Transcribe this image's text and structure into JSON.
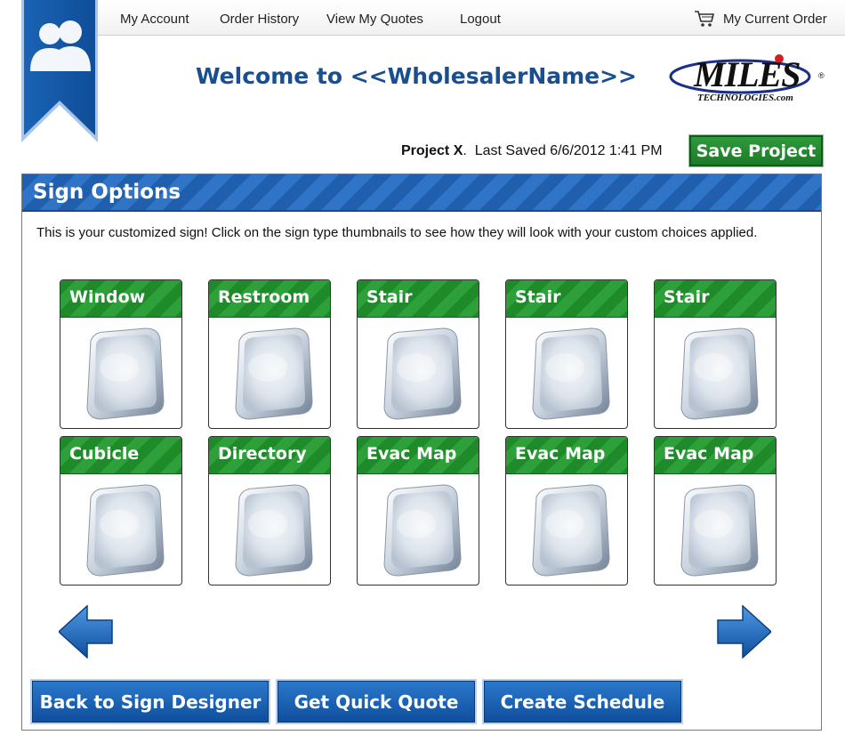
{
  "nav": {
    "my_account": "My Account",
    "order_history": "Order History",
    "view_quotes": "View My Quotes",
    "logout": "Logout",
    "current_order": "My Current Order"
  },
  "header": {
    "welcome": "Welcome to <<WholesalerName>>",
    "logo_main": "MILES",
    "logo_sub": "TECHNOLOGIES.com",
    "logo_reg": "®"
  },
  "project": {
    "name": "Project X",
    "separator": ".",
    "saved_text": "Last Saved 6/6/2012  1:41 PM",
    "save_button": "Save Project"
  },
  "panel": {
    "title": "Sign Options",
    "intro": "This is your customized sign!  Click on the sign type thumbnails to see how they will look with your custom choices applied."
  },
  "thumbnails": [
    {
      "label": "Window"
    },
    {
      "label": "Restroom"
    },
    {
      "label": "Stair"
    },
    {
      "label": "Stair"
    },
    {
      "label": "Stair"
    },
    {
      "label": "Cubicle"
    },
    {
      "label": "Directory"
    },
    {
      "label": "Evac Map"
    },
    {
      "label": "Evac Map"
    },
    {
      "label": "Evac Map"
    }
  ],
  "buttons": {
    "back": "Back to Sign Designer",
    "quote": "Get Quick Quote",
    "schedule": "Create Schedule"
  },
  "colors": {
    "brand_blue": "#1a4f8f",
    "header_blue": "#1f5fae",
    "save_green": "#2f9a3b",
    "thumb_green": "#1f8a2a"
  }
}
